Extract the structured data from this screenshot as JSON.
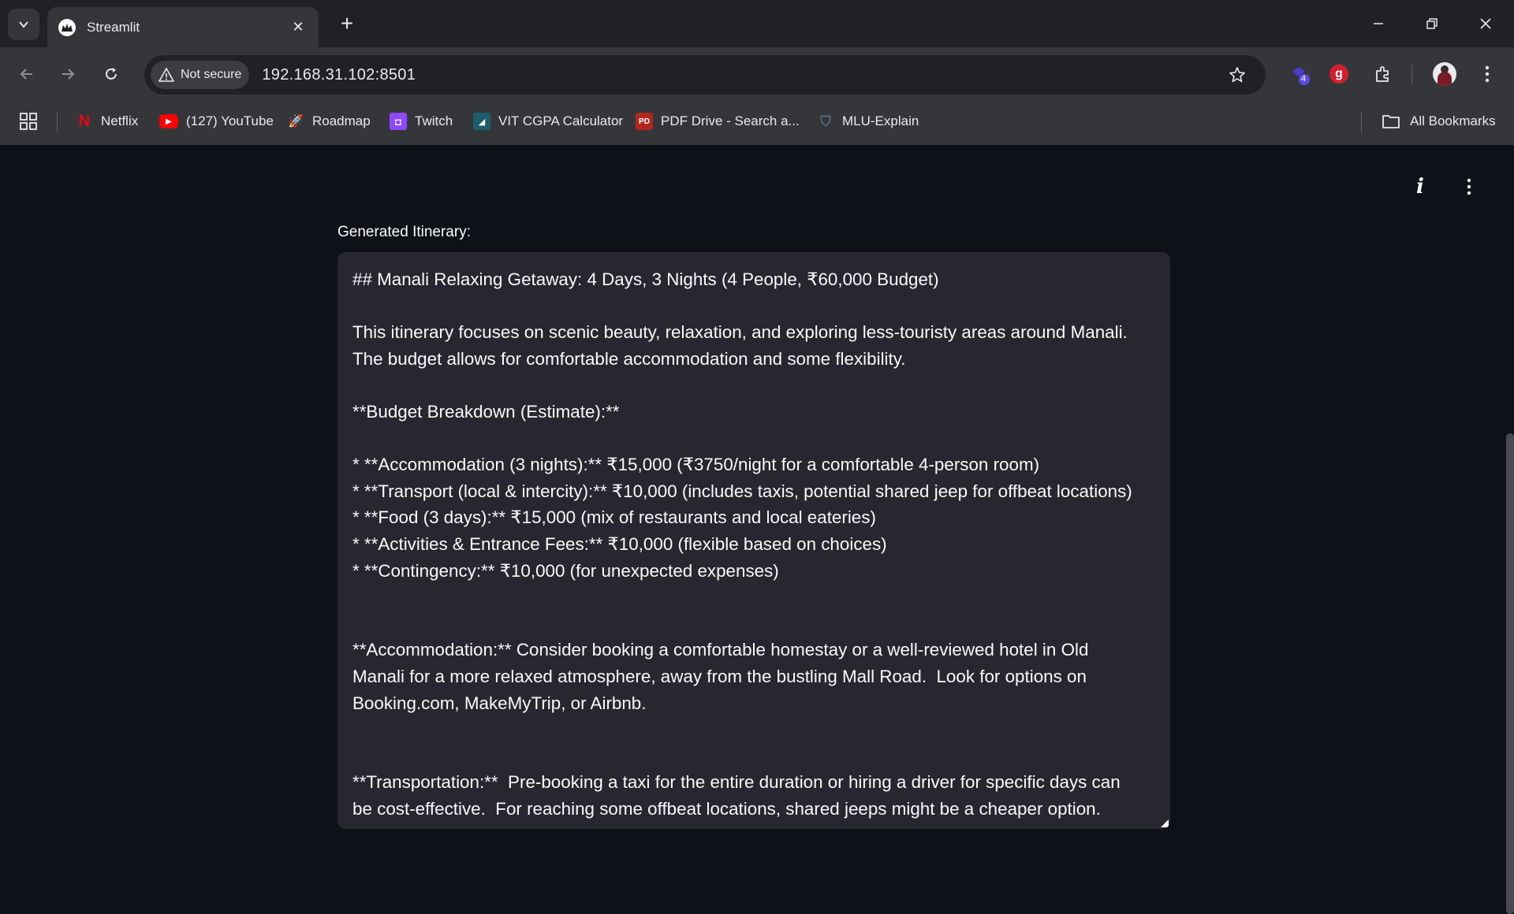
{
  "tab": {
    "title": "Streamlit"
  },
  "address_bar": {
    "security": "Not secure",
    "url": "192.168.31.102:8501"
  },
  "extensions": {
    "badge_count": "4"
  },
  "bookmarks": {
    "items": [
      {
        "label": "Netflix"
      },
      {
        "label": "(127) YouTube"
      },
      {
        "label": "Roadmap"
      },
      {
        "label": "Twitch"
      },
      {
        "label": "VIT CGPA Calculator"
      },
      {
        "label": "PDF Drive - Search a..."
      },
      {
        "label": "MLU-Explain"
      }
    ],
    "all_bookmarks": "All Bookmarks"
  },
  "app": {
    "field_label": "Generated Itinerary:",
    "itinerary_lines": [
      "## Manali Relaxing Getaway: 4 Days, 3 Nights (4 People, ₹60,000 Budget)",
      "",
      "This itinerary focuses on scenic beauty, relaxation, and exploring less-touristy areas around Manali.",
      "The budget allows for comfortable accommodation and some flexibility.",
      "",
      "**Budget Breakdown (Estimate):**",
      "",
      "* **Accommodation (3 nights):** ₹15,000 (₹3750/night for a comfortable 4-person room)",
      "* **Transport (local & intercity):** ₹10,000 (includes taxis, potential shared jeep for offbeat locations)",
      "* **Food (3 days):** ₹15,000 (mix of restaurants and local eateries)",
      "* **Activities & Entrance Fees:** ₹10,000 (flexible based on choices)",
      "* **Contingency:** ₹10,000 (for unexpected expenses)",
      "",
      "",
      "**Accommodation:** Consider booking a comfortable homestay or a well-reviewed hotel in Old",
      "Manali for a more relaxed atmosphere, away from the bustling Mall Road.  Look for options on",
      "Booking.com, MakeMyTrip, or Airbnb.",
      "",
      "",
      "**Transportation:**  Pre-booking a taxi for the entire duration or hiring a driver for specific days can",
      "be cost-effective.  For reaching some offbeat locations, shared jeeps might be a cheaper option."
    ]
  }
}
